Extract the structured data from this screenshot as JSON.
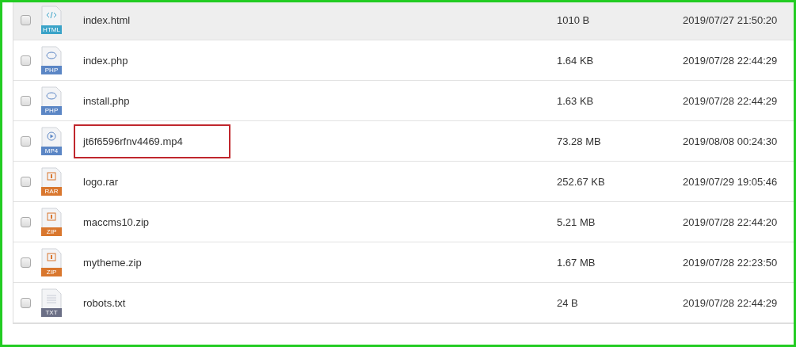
{
  "files": [
    {
      "name": "index.html",
      "kind": "code",
      "badge": "HTML",
      "size": "1010 B",
      "modified": "2019/07/27 21:50:20",
      "checked": false,
      "hovered": true,
      "highlighted": false
    },
    {
      "name": "index.php",
      "kind": "php",
      "badge": "PHP",
      "size": "1.64 KB",
      "modified": "2019/07/28 22:44:29",
      "checked": false,
      "hovered": false,
      "highlighted": false
    },
    {
      "name": "install.php",
      "kind": "php",
      "badge": "PHP",
      "size": "1.63 KB",
      "modified": "2019/07/28 22:44:29",
      "checked": false,
      "hovered": false,
      "highlighted": false
    },
    {
      "name": "jt6f6596rfnv4469.mp4",
      "kind": "video",
      "badge": "MP4",
      "size": "73.28 MB",
      "modified": "2019/08/08 00:24:30",
      "checked": false,
      "hovered": false,
      "highlighted": true
    },
    {
      "name": "logo.rar",
      "kind": "archive",
      "badge": "RAR",
      "size": "252.67 KB",
      "modified": "2019/07/29 19:05:46",
      "checked": false,
      "hovered": false,
      "highlighted": false
    },
    {
      "name": "maccms10.zip",
      "kind": "archive",
      "badge": "ZIP",
      "size": "5.21 MB",
      "modified": "2019/07/28 22:44:20",
      "checked": false,
      "hovered": false,
      "highlighted": false
    },
    {
      "name": "mytheme.zip",
      "kind": "archive",
      "badge": "ZIP",
      "size": "1.67 MB",
      "modified": "2019/07/28 22:23:50",
      "checked": false,
      "hovered": false,
      "highlighted": false
    },
    {
      "name": "robots.txt",
      "kind": "text",
      "badge": "TXT",
      "size": "24 B",
      "modified": "2019/07/28 22:44:29",
      "checked": false,
      "hovered": false,
      "highlighted": false
    }
  ]
}
